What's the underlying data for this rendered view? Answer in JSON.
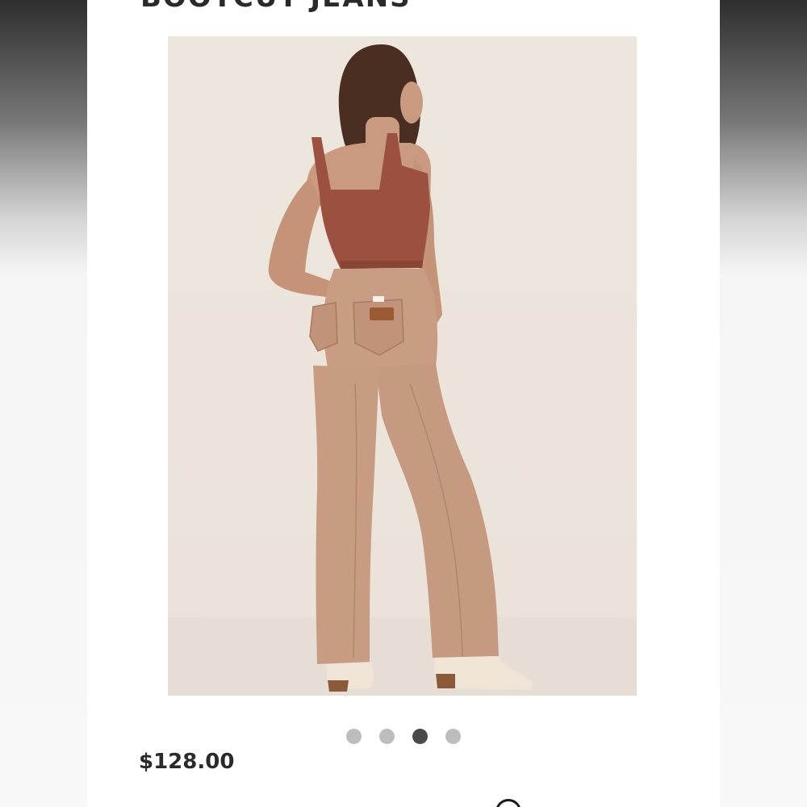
{
  "product": {
    "title": "BOOTCUT JEANS",
    "price": "$128.00",
    "image_alt": "Model wearing tan high-rise bootcut jeans and rust tank top, back view"
  },
  "carousel": {
    "count": 4,
    "active_index": 2
  },
  "colors": {
    "active_dot": "#4a4a4a",
    "inactive_dot": "#bdbdbd",
    "title_text": "#2a2a2a"
  },
  "icons": [
    "circle-icon"
  ]
}
